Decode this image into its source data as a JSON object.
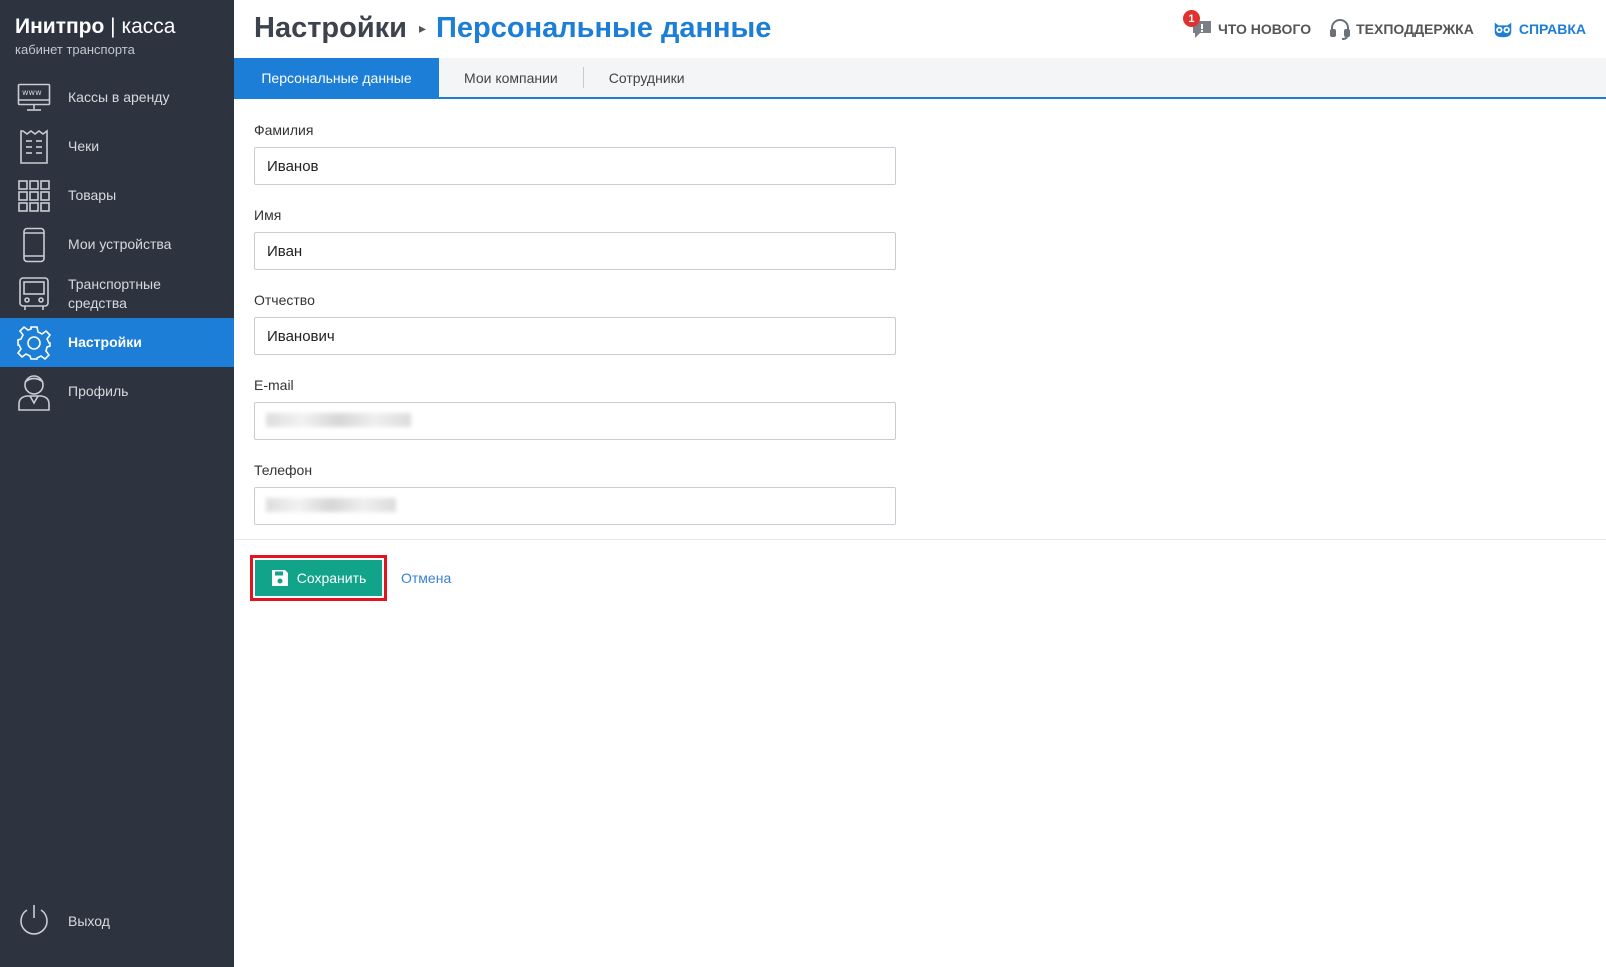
{
  "brand": {
    "name_bold": "Инитпро",
    "divider": " | ",
    "name_thin": "касса",
    "subtitle": "кабинет транспорта"
  },
  "sidebar": {
    "items": [
      {
        "label": "Кассы в аренду",
        "icon": "www-monitor-icon",
        "active": false
      },
      {
        "label": "Чеки",
        "icon": "receipt-icon",
        "active": false
      },
      {
        "label": "Товары",
        "icon": "grid-icon",
        "active": false
      },
      {
        "label": "Мои устройства",
        "icon": "smartphone-icon",
        "active": false
      },
      {
        "label": "Транспортные средства",
        "icon": "bus-icon",
        "active": false
      },
      {
        "label": "Настройки",
        "icon": "gear-icon",
        "active": true
      },
      {
        "label": "Профиль",
        "icon": "user-icon",
        "active": false
      }
    ],
    "logout": {
      "label": "Выход",
      "icon": "power-icon"
    }
  },
  "header": {
    "breadcrumb_root": "Настройки",
    "breadcrumb_sep": "▸",
    "breadcrumb_current": "Персональные данные",
    "links": {
      "news": {
        "label": "Что нового",
        "badge": "1",
        "icon": "chat-icon"
      },
      "support": {
        "label": "Техподдержка",
        "icon": "headset-icon"
      },
      "help": {
        "label": "Справка",
        "icon": "owl-icon"
      }
    }
  },
  "tabs": [
    {
      "label": "Персональные данные",
      "active": true
    },
    {
      "label": "Мои компании",
      "active": false
    },
    {
      "label": "Сотрудники",
      "active": false
    }
  ],
  "form": {
    "last_name": {
      "label": "Фамилия",
      "value": "Иванов"
    },
    "first_name": {
      "label": "Имя",
      "value": "Иван"
    },
    "patronymic": {
      "label": "Отчество",
      "value": "Иванович"
    },
    "email": {
      "label": "E-mail",
      "value": ""
    },
    "phone": {
      "label": "Телефон",
      "value": ""
    }
  },
  "actions": {
    "save_label": "Сохранить",
    "cancel_label": "Отмена"
  },
  "colors": {
    "sidebar_bg": "#2d3440",
    "accent": "#1c7ed6",
    "save_button": "#12a38b",
    "highlight_outline": "#e3141f",
    "badge": "#e03131"
  }
}
